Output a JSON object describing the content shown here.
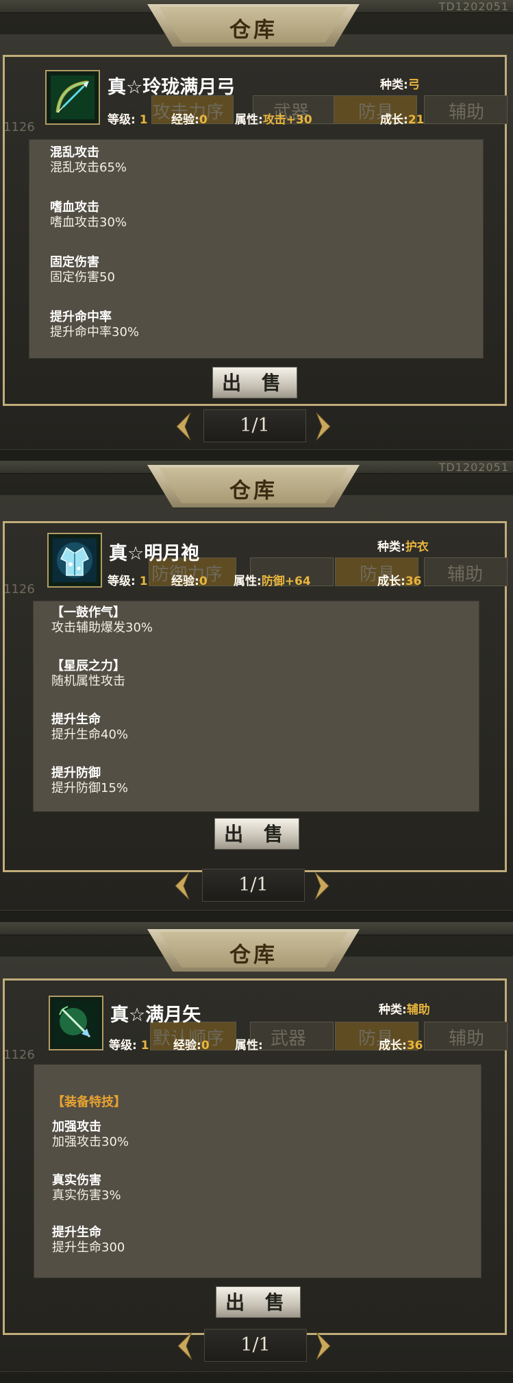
{
  "title": "仓库",
  "background_code": "TD1202051",
  "background_number": "1126",
  "background_tabs": [
    "攻击力序",
    "武器",
    "防具",
    "辅助",
    "防御力序",
    "默认顺序"
  ],
  "labels": {
    "level": "等级:",
    "exp": "经验:",
    "attr": "属性:",
    "growth": "成长:",
    "kind": "种类:"
  },
  "sell_label": "出 售",
  "pager": "1/1",
  "colors": {
    "accent": "#e9b53c",
    "panel_border": "#c2ad7a",
    "section": "#e9a330"
  },
  "screens": [
    {
      "name": "真☆玲珑满月弓",
      "icon": "bow-icon",
      "kind": "弓",
      "level": "1",
      "exp": "0",
      "attr": "攻击+30",
      "growth": "21",
      "blocks": [
        {
          "h": "混乱攻击",
          "d": "混乱攻击65%"
        },
        {
          "h": "嗜血攻击",
          "d": "嗜血攻击30%"
        },
        {
          "h": "固定伤害",
          "d": "固定伤害50"
        },
        {
          "h": "提升命中率",
          "d": "提升命中率30%"
        }
      ]
    },
    {
      "name": "真☆明月袍",
      "icon": "robe-icon",
      "kind": "护衣",
      "level": "1",
      "exp": "0",
      "attr": "防御+64",
      "growth": "36",
      "blocks": [
        {
          "h": "【一鼓作气】",
          "d": "攻击辅助爆发30%"
        },
        {
          "h": "【星辰之力】",
          "d": "随机属性攻击"
        },
        {
          "h": "提升生命",
          "d": "提升生命40%"
        },
        {
          "h": "提升防御",
          "d": "提升防御15%"
        }
      ]
    },
    {
      "name": "真☆满月矢",
      "icon": "arrow-icon",
      "kind": "辅助",
      "level": "1",
      "exp": "0",
      "attr": "",
      "growth": "36",
      "section": "【装备特技】",
      "blocks": [
        {
          "h": "加强攻击",
          "d": "加强攻击30%"
        },
        {
          "h": "真实伤害",
          "d": "真实伤害3%"
        },
        {
          "h": "提升生命",
          "d": "提升生命300"
        }
      ]
    }
  ]
}
